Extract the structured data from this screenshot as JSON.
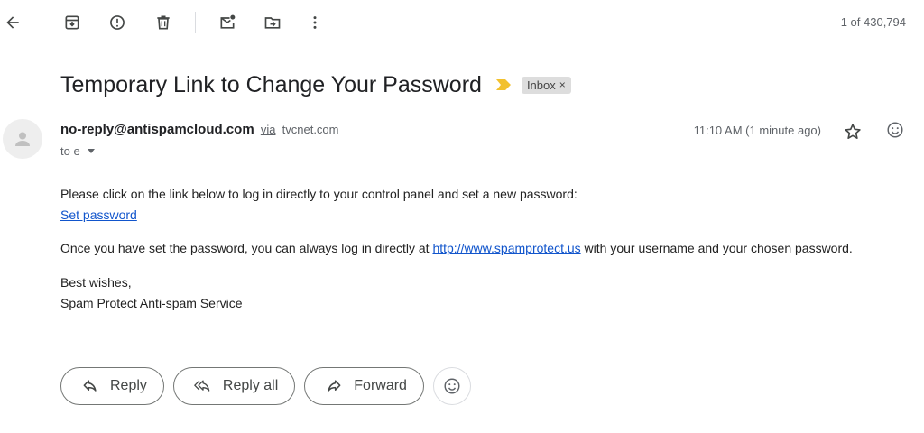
{
  "toolbar": {
    "icons": [
      "back-arrow-icon",
      "archive-icon",
      "report-spam-icon",
      "delete-icon",
      "mark-unread-icon",
      "move-to-icon",
      "more-vert-icon"
    ],
    "counter": "1 of 430,794"
  },
  "email": {
    "subject": "Temporary Link to Change Your Password",
    "label": "Inbox",
    "label_close": "×",
    "sender": "no-reply@antispamcloud.com",
    "via": "via",
    "via_domain": "tvcnet.com",
    "to": "to e",
    "time": "11:10 AM (1 minute ago)",
    "body": {
      "line1": "Please click on the link below to log in directly to your control panel and set a new password:",
      "link1": "Set password",
      "line2_before": "Once you have set the password, you can always log in directly at ",
      "link2": "http://www.spamprotect.us",
      "line2_after": " with your username and your chosen password.",
      "sign1": "Best wishes,",
      "sign2": "Spam Protect Anti-spam Service"
    }
  },
  "actions": {
    "reply": "Reply",
    "reply_all": "Reply all",
    "forward": "Forward"
  },
  "colors": {
    "link": "#1155cc",
    "importance": "#f2c12e",
    "label_bg": "#dddddd"
  }
}
